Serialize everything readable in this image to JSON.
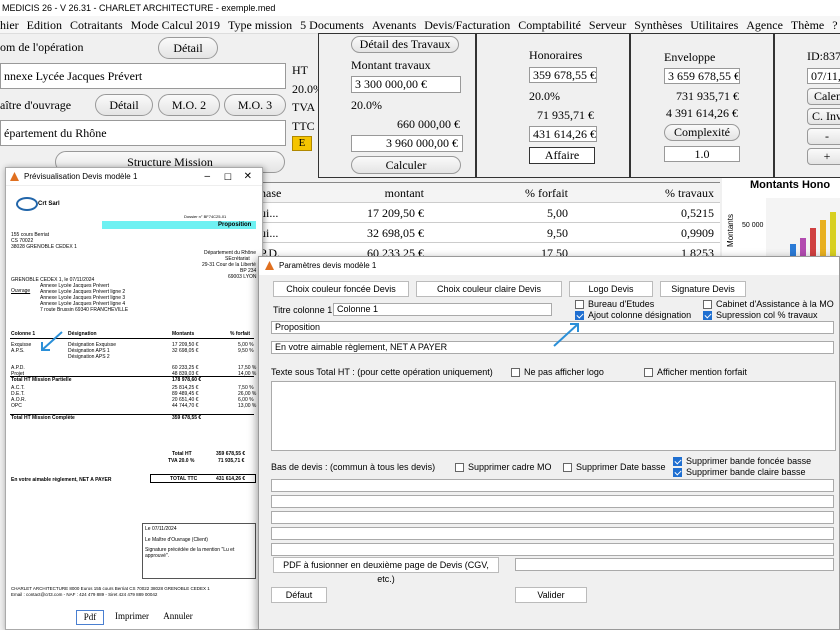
{
  "app": {
    "title": "MEDICIS 26  - V 26.31 - CHARLET ARCHITECTURE - exemple.med"
  },
  "menu": [
    "hier",
    "Edition",
    "Cotraitants",
    "Mode Calcul 2019",
    "Type mission",
    "5 Documents",
    "Avenants",
    "Devis/Facturation",
    "Comptabilité",
    "Serveur",
    "Synthèses",
    "Utilitaires",
    "Agence",
    "Thème",
    "?"
  ],
  "left": {
    "nom_operation_label": "om de l'opération",
    "detail_btn": "Détail",
    "operation_value": "nnexe Lycée Jacques Prévert",
    "maitre_label": "aître d'ouvrage",
    "detail_btn2": "Détail",
    "mo2": "M.O. 2",
    "mo3": "M.O. 3",
    "maitre_value": "épartement du Rhône",
    "structure_btn": "Structure Mission"
  },
  "amounts": {
    "ht": "HT",
    "taux": "20.0%",
    "tva": "TVA",
    "ttc": "TTC",
    "e": "E",
    "detail_travaux": "Détail des Travaux",
    "montant_travaux_label": "Montant travaux",
    "montant_travaux": "3 300 000,00 €",
    "tva_value": "660 000,00 €",
    "ttc_value": "3 960 000,00 €",
    "calculer": "Calculer"
  },
  "honoraires": {
    "title": "Honoraires",
    "ht": "359 678,55 €",
    "taux": "20.0%",
    "tva": "71 935,71 €",
    "ttc": "431 614,26 €",
    "affaire": "Affaire"
  },
  "enveloppe": {
    "title": "Enveloppe",
    "ht": "3 659 678,55 €",
    "tva": "731 935,71 €",
    "ttc": "4 391 614,26 €",
    "complexite": "Complexité",
    "coef": "1.0"
  },
  "id_panel": {
    "id": "ID:837",
    "date": "07/11,",
    "btn1": "Calen",
    "btn2": "C. Inv"
  },
  "table": {
    "headers": [
      "hase",
      "montant",
      "% forfait",
      "% travaux"
    ],
    "rows": [
      [
        "ui...",
        "17 209,50 €",
        "5,00",
        "0,5215"
      ],
      [
        "ui...",
        "32 698,05 €",
        "9,50",
        "0,9909"
      ],
      [
        "P.D.",
        "60 233,25 €",
        "17,50",
        "1,8253"
      ]
    ]
  },
  "chart": {
    "title": "Montants Hono",
    "ylabel": "Montants",
    "tick": "50 000",
    "colors": [
      "#2b7bd6",
      "#b24bb0",
      "#d04040",
      "#e8b020",
      "#9ac030",
      "#d8d020"
    ]
  },
  "preview": {
    "title": "Prévisualisation Devis modèle 1",
    "company": "Crt Sarl",
    "dossier": "Dossier n° BF74C25-01",
    "proposition": "Proposition",
    "address": [
      "155 cours Berriat",
      "CS 70022",
      "38028 GRENOBLE CEDEX 1"
    ],
    "client": [
      "Département du Rhône",
      "SEcrétariat",
      "29-31 Cour de la Liberté",
      "BP 234",
      "69003 LYON"
    ],
    "date_line": "GRENOBLE CEDEX 1, le 07/11/2024",
    "ouvrage_label": "Ouvrage",
    "ouvrage": [
      "Annexe Lycée Jacques Prévert",
      "Annexe Lycée Jacques Prévert ligne 2",
      "Annexe Lycée Jacques Prévert ligne 3",
      "Annexe Lycée Jacques Prévert ligne 4",
      "7 route Brussin 69340 FRANCHEVILLE"
    ],
    "cols": [
      "Colonne 1",
      "Désignation",
      "Montants",
      "% forfait"
    ],
    "lines": [
      [
        "Exquisse",
        "Désignation Exquisse",
        "17 209,50 €",
        "5,00 %"
      ],
      [
        "A.P.S.",
        "Désignation APS 1",
        "32 698,05 €",
        "9,50 %"
      ],
      [
        "",
        "Désignation APS 2",
        "",
        ""
      ],
      [
        "A.P.D.",
        "",
        "60 233,25 €",
        "17,50 %"
      ],
      [
        "Projet",
        "",
        "48 839,03 €",
        "14,00 %"
      ],
      [
        "Total HT Mission Partielle",
        "",
        "178 978,60 €",
        ""
      ],
      [
        "A.C.T.",
        "",
        "25 814,25 €",
        "7,50 %"
      ],
      [
        "D.E.T.",
        "",
        "89 489,45 €",
        "26,00 %"
      ],
      [
        "A.O.R.",
        "",
        "20 651,40 €",
        "6,00 %"
      ],
      [
        "OPC",
        "",
        "44 744,70 €",
        "13,00 %"
      ],
      [
        "Total HT Mission Complète",
        "",
        "359 678,55 €",
        ""
      ]
    ],
    "total_ht_label": "Total HT",
    "total_ht": "359 678,55 €",
    "tva_label": "TVA 20.0 %",
    "tva": "71 935,71 €",
    "reglement": "En votre aimable règlement, NET A PAYER",
    "total_ttc_label": "TOTAL TTC",
    "total_ttc": "431 614,26 €",
    "sign_date": "Le 07/11/2024",
    "sign_client": "Le Maître d'Ouvrage (Client)",
    "sign_note": "Signature précédée de la mention \"Lu et approuvé\".",
    "footer1": "CHARLET ARCHITECTURE 8000 Euros 155 cours Berriat CS 70022 38028 GRENOBLE CEDEX 1",
    "footer2": "Email : contact@crt3.com  -  NAF : 424 479 889 - Siret 424 479 889 00042",
    "btn_pdf": "Pdf",
    "btn_print": "Imprimer",
    "btn_cancel": "Annuler"
  },
  "params": {
    "title": "Paramètres devis modèle 1",
    "btn_couleur_foncee": "Choix couleur foncée Devis",
    "btn_couleur_claire": "Choix couleur claire Devis",
    "btn_logo": "Logo Devis",
    "btn_signature": "Signature Devis",
    "titre_colonne_label": "Titre colonne 1",
    "titre_colonne_value": "Colonne 1",
    "cb_bureau": "Bureau d'Etudes",
    "cb_cabinet": "Cabinet d'Assistance à la MO",
    "cb_ajout": "Ajout colonne désignation",
    "cb_suppression": "Supression col % travaux",
    "proposition_value": "Proposition",
    "reglement_value": "En votre aimable règlement, NET A PAYER",
    "texte_sous_total_label": "Texte sous Total HT :  (pour cette opération uniquement)",
    "cb_ne_pas_logo": "Ne pas afficher logo",
    "cb_mention": "Afficher mention forfait",
    "bas_devis_label": "Bas de devis : (commun à tous les devis)",
    "cb_cadre_mo": "Supprimer cadre MO",
    "cb_date_basse": "Supprimer Date basse",
    "cb_bande_foncee": "Supprimer bande foncée basse",
    "cb_bande_claire": "Supprimer bande claire basse",
    "btn_pdf_fusion": "PDF à fusionner en deuxième page de Devis (CGV, etc.)",
    "btn_defaut": "Défaut",
    "btn_valider": "Valider"
  }
}
